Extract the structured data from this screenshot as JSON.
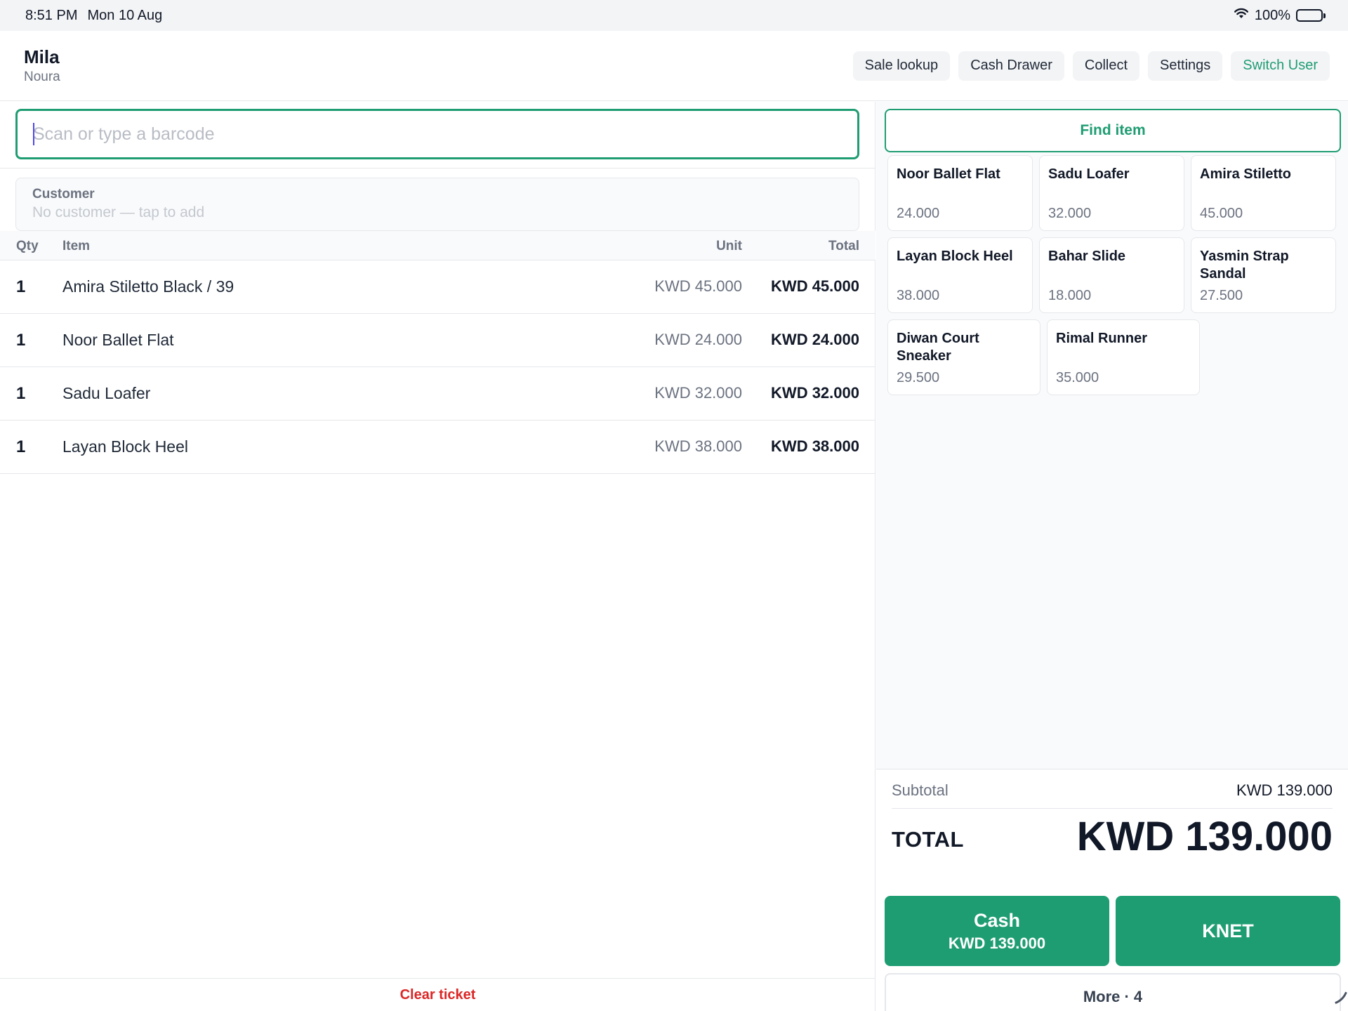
{
  "status_bar": {
    "time": "8:51 PM",
    "date": "Mon 10 Aug",
    "battery": "100%"
  },
  "header": {
    "user_name": "Mila",
    "user_sub": "Noura",
    "actions": [
      "Sale lookup",
      "Cash Drawer",
      "Collect",
      "Settings",
      "Switch User"
    ]
  },
  "barcode": {
    "placeholder": "Scan or type a barcode",
    "value": ""
  },
  "customer": {
    "label": "Customer",
    "value": "No customer — tap to add"
  },
  "ticket": {
    "columns": {
      "qty": "Qty",
      "item": "Item",
      "unit": "Unit",
      "total": "Total"
    },
    "rows": [
      {
        "qty": "1",
        "name": "Amira Stiletto Black / 39",
        "unit": "KWD 45.000",
        "total": "KWD 45.000"
      },
      {
        "qty": "1",
        "name": "Noor Ballet Flat",
        "unit": "KWD 24.000",
        "total": "KWD 24.000"
      },
      {
        "qty": "1",
        "name": "Sadu Loafer",
        "unit": "KWD 32.000",
        "total": "KWD 32.000"
      },
      {
        "qty": "1",
        "name": "Layan Block Heel",
        "unit": "KWD 38.000",
        "total": "KWD 38.000"
      }
    ],
    "clear_label": "Clear ticket"
  },
  "catalog": {
    "find_label": "Find item",
    "tiles": [
      {
        "name": "Noor Ballet Flat",
        "price": "24.000"
      },
      {
        "name": "Sadu Loafer",
        "price": "32.000"
      },
      {
        "name": "Amira Stiletto",
        "price": "45.000"
      },
      {
        "name": "Layan Block Heel",
        "price": "38.000"
      },
      {
        "name": "Bahar Slide",
        "price": "18.000"
      },
      {
        "name": "Yasmin Strap Sandal",
        "price": "27.500"
      },
      {
        "name": "Diwan Court Sneaker",
        "price": "29.500"
      },
      {
        "name": "Rimal Runner",
        "price": "35.000"
      }
    ]
  },
  "totals": {
    "subtotal_label": "Subtotal",
    "subtotal_value": "KWD 139.000",
    "total_label": "TOTAL",
    "total_value": "KWD 139.000"
  },
  "payment": {
    "cash_label": "Cash",
    "cash_amount": "KWD 139.000",
    "knet_label": "KNET",
    "more_label": "More · 4"
  },
  "colors": {
    "accent": "#1f9d72",
    "danger": "#dc2626",
    "caret": "#4f46e5"
  }
}
